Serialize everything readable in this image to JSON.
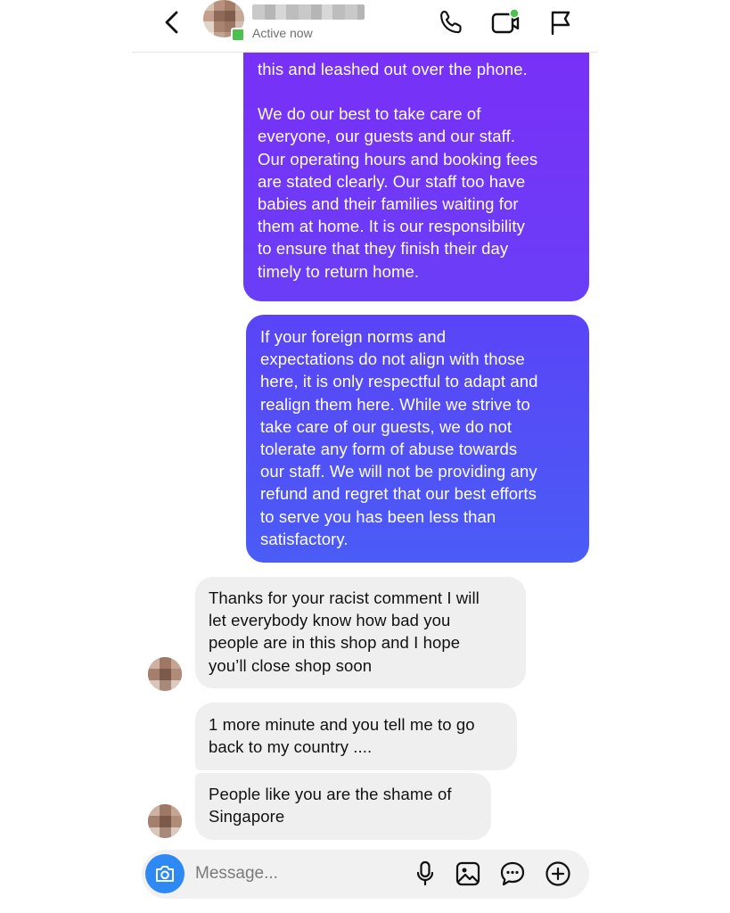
{
  "header": {
    "status": "Active now",
    "icons": [
      "back-chevron-icon",
      "phone-icon",
      "video-camera-icon",
      "flag-icon"
    ],
    "presence_color": "#4cc14f"
  },
  "messages": [
    {
      "direction": "outgoing",
      "paragraphs": [
        [
          "this and leashed out over the phone."
        ],
        [
          "We do our best to take care of",
          "everyone, our guests and our staff.",
          "Our operating hours and booking fees",
          "are stated clearly. Our staff too have",
          "babies and their families waiting for",
          "them at home. It is our responsibility",
          "to ensure that they finish their day",
          "timely to return home."
        ]
      ]
    },
    {
      "direction": "outgoing",
      "lines": [
        "If your foreign norms and",
        "expectations do not align with those",
        "here, it is only respectful to adapt and",
        "realign them here. While we strive to",
        "take care of our guests, we do not",
        "tolerate any form of abuse towards",
        "our staff. We will not be providing any",
        "refund and regret that our best efforts",
        "to serve you has been less than",
        "satisfactory."
      ]
    },
    {
      "direction": "incoming",
      "lines": [
        "Thanks for your racist comment I will",
        "let everybody know how bad you",
        "people are in this shop and I hope",
        "you’ll close shop soon"
      ]
    },
    {
      "direction": "incoming",
      "lines": [
        "1 more minute and you tell me to go",
        "back to my country ...."
      ]
    },
    {
      "direction": "incoming",
      "lines": [
        "People like you are the shame of",
        "Singapore"
      ]
    }
  ],
  "composer": {
    "placeholder": "Message...",
    "camera_color": "#2f89f5",
    "icons": [
      "camera-icon",
      "microphone-icon",
      "image-icon",
      "sticker-icon",
      "plus-circle-icon"
    ]
  },
  "colors": {
    "outgoing_gradient_top": "#7a2ff7",
    "outgoing_gradient_bottom": "#4a5cf6",
    "incoming_bubble": "#efefef"
  }
}
